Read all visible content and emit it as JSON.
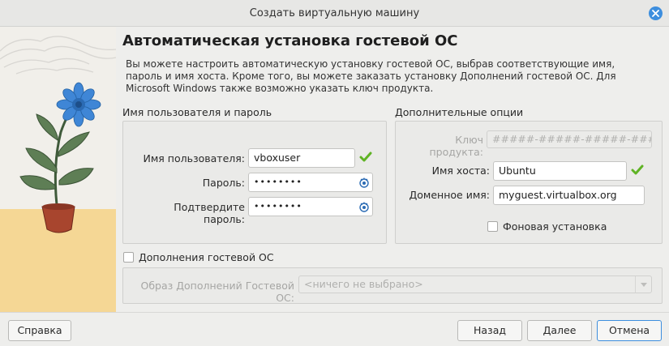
{
  "window": {
    "title": "Создать виртуальную машину"
  },
  "page": {
    "heading": "Автоматическая установка гостевой ОС",
    "description": "Вы можете настроить автоматическую установку гостевой ОС, выбрав соответствующие имя, пароль и имя хоста. Кроме того, вы можете заказать установку Дополнений гостевой ОС. Для Microsoft Windows также возможно указать ключ продукта."
  },
  "credentials": {
    "group_label": "Имя пользователя и пароль",
    "username_label": "Имя пользователя:",
    "username_value": "vboxuser",
    "password_label": "Пароль:",
    "password_value": "••••••••",
    "confirm_label": "Подтвердите пароль:",
    "confirm_value": "••••••••"
  },
  "options": {
    "group_label": "Дополнительные опции",
    "product_key_label": "Ключ продукта:",
    "product_key_placeholder": "#####-#####-#####-#####-#####",
    "hostname_label": "Имя хоста:",
    "hostname_value": "Ubuntu",
    "domain_label": "Доменное имя:",
    "domain_value": "myguest.virtualbox.org",
    "unattended_label": "Фоновая установка",
    "unattended_checked": false
  },
  "guest_additions": {
    "checkbox_label": "Дополнения гостевой ОС",
    "checked": false,
    "iso_label": "Образ Дополнений Гостевой ОС:",
    "iso_value": "<ничего не выбрано>"
  },
  "buttons": {
    "help": "Справка",
    "back": "Назад",
    "next": "Далее",
    "cancel": "Отмена"
  },
  "colors": {
    "accent": "#3d8ede",
    "valid_check": "#5fb324"
  },
  "icons": [
    "close-icon",
    "valid-check-icon",
    "show-password-icon",
    "dropdown-arrow-icon"
  ]
}
